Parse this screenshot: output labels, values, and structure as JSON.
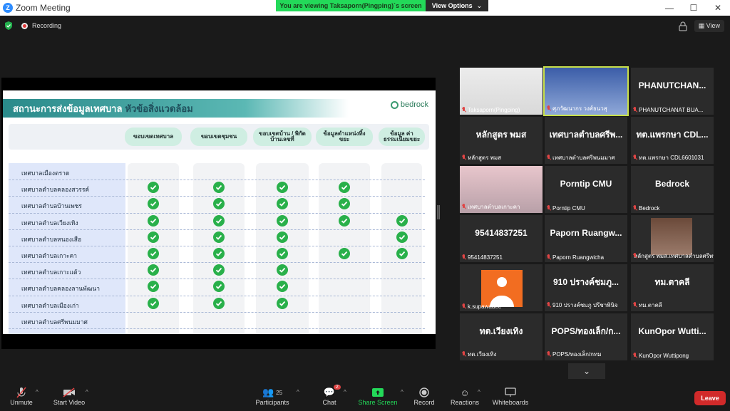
{
  "window": {
    "title": "Zoom Meeting",
    "controls": [
      "—",
      "☐",
      "✕"
    ]
  },
  "banner": {
    "message": "You are viewing Taksaporn(Pingping)`s screen",
    "view_options": "View Options"
  },
  "topbar": {
    "recording": "Recording",
    "view": "View"
  },
  "slide": {
    "title_main": "สถานะการส่งข้อมูลเทศบาล",
    "title_accent": "หัวข้อสิ่งแวดล้อม",
    "brand": "bedrock",
    "columns": [
      "ขอบเขตเทศบาล",
      "ขอบเขตชุมชน",
      "ขอบเขตบ้าน / พิกัดบ้านเลขที่",
      "ข้อมูลตำแหน่งทิ้งขยะ",
      "ข้อมูล ค่าธรรมเนียมขยะ"
    ],
    "rows": [
      {
        "name": "เทศบาลเมืองตราด",
        "checks": [
          false,
          false,
          false,
          false,
          false
        ]
      },
      {
        "name": "เทศบาลตำบลคลองสวรรค์",
        "checks": [
          true,
          true,
          true,
          true,
          false
        ]
      },
      {
        "name": "เทศบาลตำบลบ้านเพชร",
        "checks": [
          true,
          true,
          true,
          true,
          false
        ]
      },
      {
        "name": "เทศบาลตำบลเวียงเทิง",
        "checks": [
          true,
          true,
          true,
          true,
          true
        ]
      },
      {
        "name": "เทศบาลตำบลหนองเสือ",
        "checks": [
          true,
          true,
          true,
          false,
          true
        ]
      },
      {
        "name": "เทศบาลตำบลเกาะคา",
        "checks": [
          true,
          true,
          true,
          true,
          true
        ]
      },
      {
        "name": "เทศบาลตำบลเกาะแต้ว",
        "checks": [
          true,
          true,
          true,
          false,
          false
        ]
      },
      {
        "name": "เทศบาลตำบลคลองลานพัฒนา",
        "checks": [
          true,
          true,
          true,
          false,
          false
        ]
      },
      {
        "name": "เทศบาลตำบลเมืองเก่า",
        "checks": [
          true,
          true,
          true,
          false,
          false
        ]
      },
      {
        "name": "เทศบาลตำบลศรีพนมมาศ",
        "checks": [
          false,
          false,
          false,
          false,
          false
        ]
      }
    ]
  },
  "participants_grid": [
    {
      "display": "",
      "caption": "Taksaporn(Pingping)",
      "video": "vid1"
    },
    {
      "display": "",
      "caption": "ศุภวัฒนากร วงศ์ธนวสุ",
      "video": "vid2",
      "speaking": true
    },
    {
      "display": "PHANUTCHAN...",
      "caption": "PHANUTCHANAT BUA..."
    },
    {
      "display": "หลักสูตร พมส",
      "caption": "หลักสูตร พมส"
    },
    {
      "display": "เทศบาลตำบลศรีพ...",
      "caption": "เทศบาลตำบลศรีพนมมาศ"
    },
    {
      "display": "ทต.แพรกษา CDL...",
      "caption": "ทต.แพรกษา CDL6601031"
    },
    {
      "display": "",
      "caption": "เทศบาลตำบลเกาะคา",
      "video": "vid3"
    },
    {
      "display": "Porntip CMU",
      "caption": "Porntip CMU"
    },
    {
      "display": "Bedrock",
      "caption": "Bedrock"
    },
    {
      "display": "95414837251",
      "caption": "95414837251"
    },
    {
      "display": "Paporn Ruangw...",
      "caption": "Paporn Ruangwicha"
    },
    {
      "display": "",
      "caption": "หลักสูตร พมส.เทศบาลตำบลศรีพนมมาศ",
      "video": "photo"
    },
    {
      "display": "",
      "caption": "k.supawadee",
      "video": "avatar"
    },
    {
      "display": "910 ปรางค์ชมภู...",
      "caption": "910 ปรางค์ชมภู ปรีชาพินิจ"
    },
    {
      "display": "ทม.ตาคลี",
      "caption": "ทม.ตาคลี"
    },
    {
      "display": "ทต.เวียงเทิง",
      "caption": "ทต.เวียงเทิง"
    },
    {
      "display": "POPS/ทองเล็ก/ก...",
      "caption": "POPS/ทองเล็ก/กทม"
    },
    {
      "display": "KunOpor Wutti...",
      "caption": "KunOpor Wuttipong"
    }
  ],
  "toolbar": {
    "unmute": "Unmute",
    "start_video": "Start Video",
    "participants": "Participants",
    "participants_count": "25",
    "chat": "Chat",
    "chat_badge": "2",
    "share_screen": "Share Screen",
    "record": "Record",
    "reactions": "Reactions",
    "whiteboards": "Whiteboards",
    "leave": "Leave"
  },
  "colors": {
    "accent_green": "#23d959",
    "leave_red": "#d12a2a",
    "check_green": "#29b04a"
  }
}
